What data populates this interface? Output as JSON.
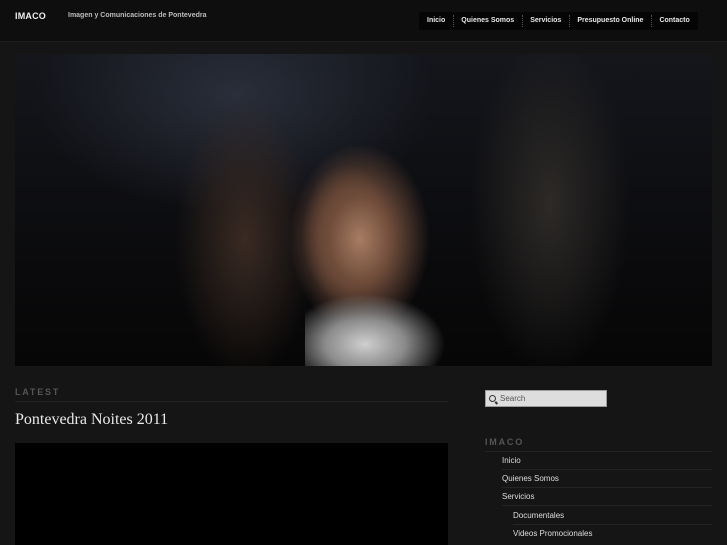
{
  "header": {
    "brand": "IMACO",
    "tagline": "Imagen y Comunicaciones de Pontevedra",
    "nav": [
      "Inicio",
      "Quienes Somos",
      "Servicios",
      "Presupuesto Online",
      "Contacto"
    ]
  },
  "content": {
    "section_label": "LATEST",
    "post_title": "Pontevedra Noites 2011"
  },
  "sidebar": {
    "search_placeholder": "Search",
    "widget_title": "IMACO",
    "links": [
      "Inicio",
      "Quienes Somos",
      "Servicios",
      "Documentales",
      "Videos Promocionales"
    ]
  }
}
